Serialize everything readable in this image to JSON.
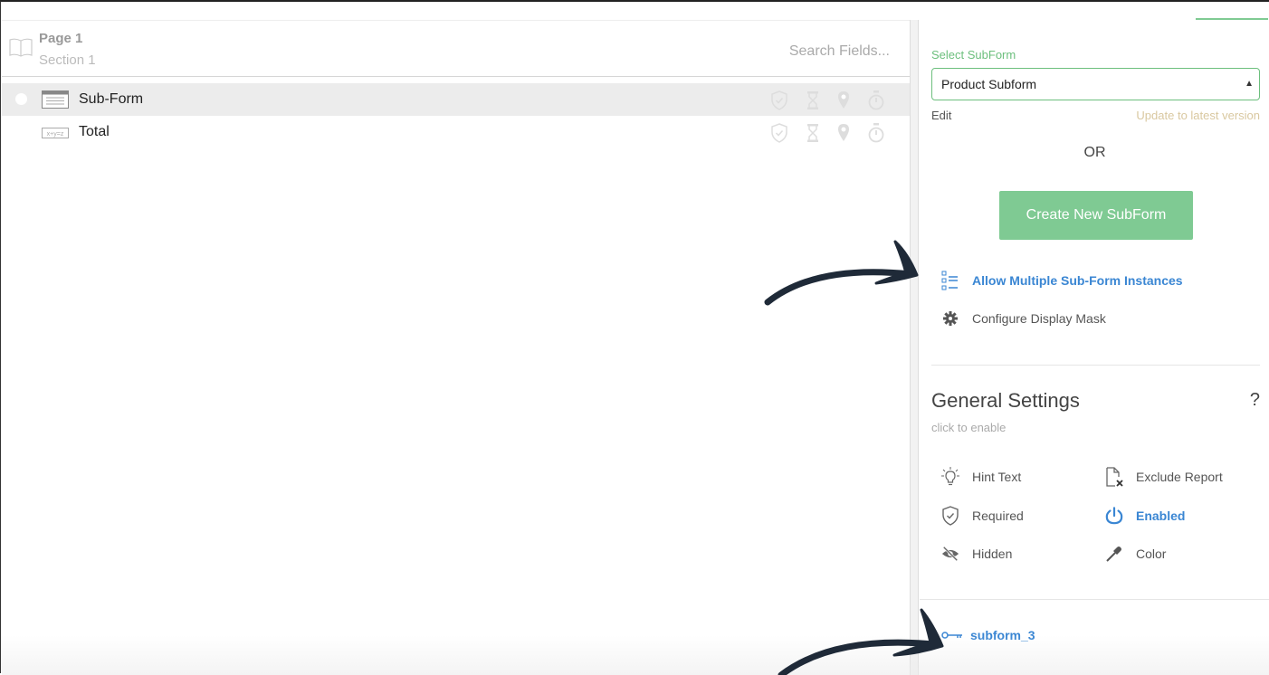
{
  "left": {
    "page_title": "Page 1",
    "section_title": "Section 1",
    "search_placeholder": "Search Fields...",
    "fields": [
      {
        "label": "Sub-Form",
        "icon": "subform-icon",
        "selected": true
      },
      {
        "label": "Total",
        "icon": "formula-icon",
        "selected": false
      }
    ]
  },
  "right": {
    "select_label": "Select SubForm",
    "select_value": "Product Subform",
    "edit_label": "Edit",
    "update_label": "Update to latest version",
    "or_label": "OR",
    "create_button": "Create New SubForm",
    "allow_multiple": "Allow Multiple Sub-Form Instances",
    "configure_mask": "Configure Display Mask",
    "general_settings": {
      "title": "General Settings",
      "help": "?",
      "subtitle": "click to enable",
      "items": {
        "hint_text": "Hint Text",
        "exclude_report": "Exclude Report",
        "required": "Required",
        "enabled": "Enabled",
        "hidden": "Hidden",
        "color": "Color"
      }
    },
    "key_name": "subform_3"
  },
  "colors": {
    "accent_green": "#7fca93",
    "link_blue": "#3a86d3",
    "arrow": "#1f2a38"
  }
}
